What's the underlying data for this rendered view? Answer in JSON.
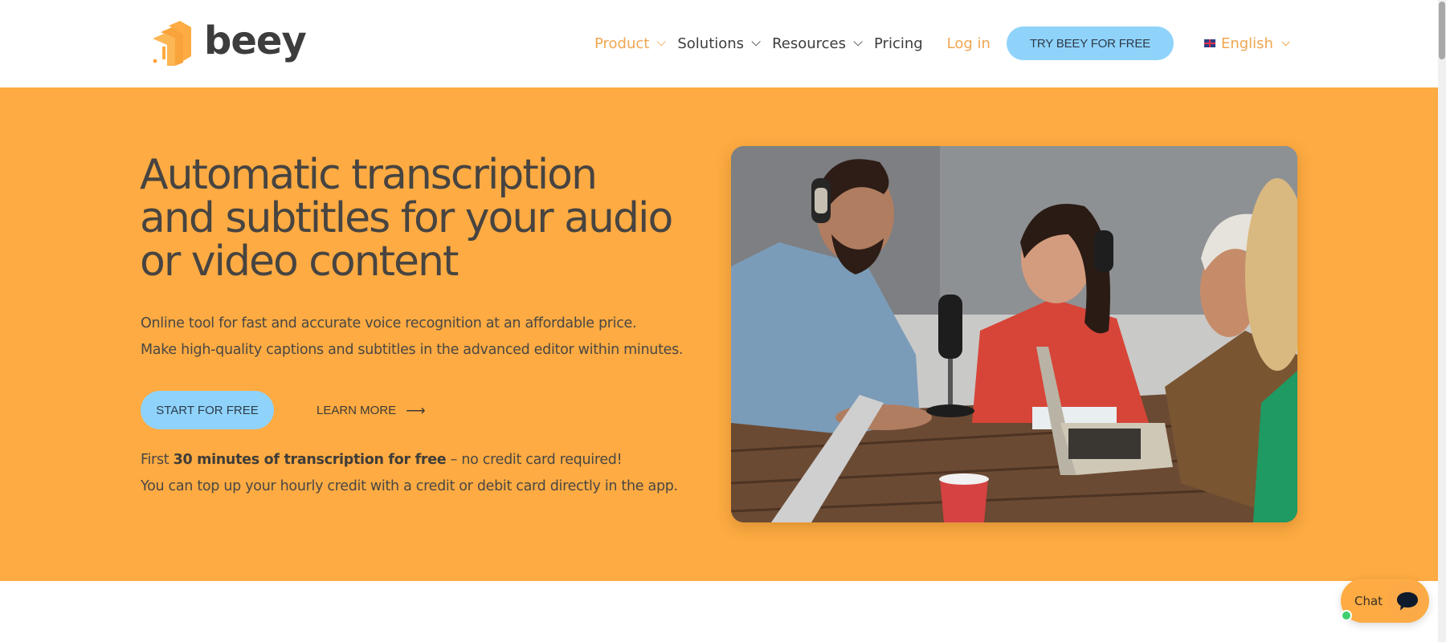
{
  "header": {
    "logo_text": "beey",
    "nav": [
      {
        "label": "Product",
        "has_dropdown": true,
        "active": true
      },
      {
        "label": "Solutions",
        "has_dropdown": true,
        "active": false
      },
      {
        "label": "Resources",
        "has_dropdown": true,
        "active": false
      },
      {
        "label": "Pricing",
        "has_dropdown": false,
        "active": false
      }
    ],
    "login_label": "Log in",
    "cta_label": "TRY BEEY FOR FREE",
    "language": {
      "label": "English",
      "flag_icon": "uk-flag-icon"
    }
  },
  "hero": {
    "title_lines": [
      "Automatic transcription",
      "and subtitles for your audio",
      "or video content"
    ],
    "description_lines": [
      "Online tool for fast and accurate voice recognition at an affordable price.",
      "Make high-quality captions and subtitles in the advanced editor within minutes."
    ],
    "start_label": "START FOR FREE",
    "learn_more_label": "LEARN MORE",
    "learn_more_icon": "arrow-right-icon",
    "note": {
      "prefix": "First ",
      "bold": "30 minutes of transcription for free",
      "suffix": " – no credit card required!",
      "line2": "You can top up your hourly credit with a credit or debit card directly in the app."
    },
    "image_alt": "People recording a podcast at a wooden table with headphones, microphone and laptops"
  },
  "chat": {
    "label": "Chat",
    "status": "online"
  },
  "colors": {
    "brand_orange": "#fdab42",
    "accent_text_orange": "#efa650",
    "cta_blue": "#8fd3fb",
    "text_dark": "#3d3d3d",
    "online_green": "#3ecf6e"
  }
}
